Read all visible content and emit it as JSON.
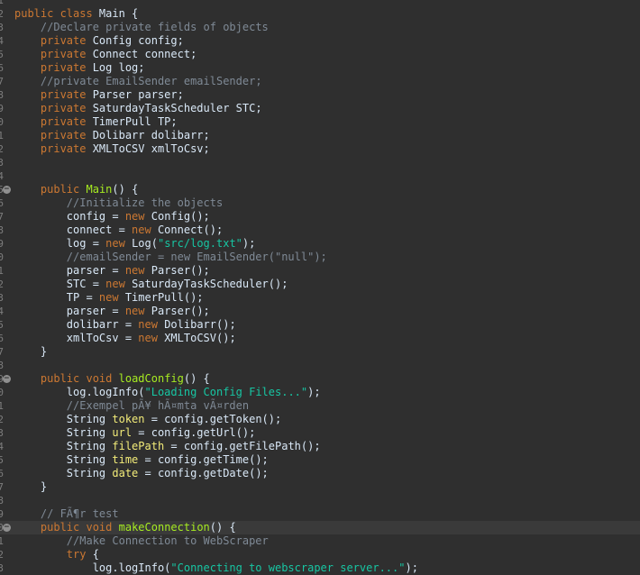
{
  "editor": {
    "language": "java",
    "highlight_line": 39,
    "colors": {
      "background": "#2f2f2f",
      "current_line": "#3a3a3a",
      "keyword": "#cc7832",
      "comment": "#7f8a96",
      "string": "#17c6a3",
      "method": "#a7ec21",
      "local_variable": "#f3ec79",
      "text": "#d9e8f7",
      "line_number": "#7d7d7d"
    },
    "lines": [
      {
        "n": "1",
        "fold": false,
        "tokens": []
      },
      {
        "n": "2",
        "fold": false,
        "tokens": [
          {
            "t": "kw",
            "v": "public class"
          },
          {
            "t": "tx",
            "v": " Main {"
          }
        ]
      },
      {
        "n": "3",
        "fold": false,
        "tokens": [
          {
            "t": "tx",
            "v": "    "
          },
          {
            "t": "cm",
            "v": "//Declare private fields of objects"
          }
        ]
      },
      {
        "n": "4",
        "fold": false,
        "tokens": [
          {
            "t": "tx",
            "v": "    "
          },
          {
            "t": "kw",
            "v": "private"
          },
          {
            "t": "tx",
            "v": " Config config;"
          }
        ]
      },
      {
        "n": "5",
        "fold": false,
        "tokens": [
          {
            "t": "tx",
            "v": "    "
          },
          {
            "t": "kw",
            "v": "private"
          },
          {
            "t": "tx",
            "v": " Connect connect;"
          }
        ]
      },
      {
        "n": "6",
        "fold": false,
        "tokens": [
          {
            "t": "tx",
            "v": "    "
          },
          {
            "t": "kw",
            "v": "private"
          },
          {
            "t": "tx",
            "v": " Log log;"
          }
        ]
      },
      {
        "n": "7",
        "fold": false,
        "tokens": [
          {
            "t": "tx",
            "v": "    "
          },
          {
            "t": "cm",
            "v": "//private EmailSender emailSender;"
          }
        ]
      },
      {
        "n": "8",
        "fold": false,
        "tokens": [
          {
            "t": "tx",
            "v": "    "
          },
          {
            "t": "kw",
            "v": "private"
          },
          {
            "t": "tx",
            "v": " Parser parser;"
          }
        ]
      },
      {
        "n": "9",
        "fold": false,
        "tokens": [
          {
            "t": "tx",
            "v": "    "
          },
          {
            "t": "kw",
            "v": "private"
          },
          {
            "t": "tx",
            "v": " SaturdayTaskScheduler STC;"
          }
        ]
      },
      {
        "n": "0",
        "fold": false,
        "tokens": [
          {
            "t": "tx",
            "v": "    "
          },
          {
            "t": "kw",
            "v": "private"
          },
          {
            "t": "tx",
            "v": " TimerPull TP;"
          }
        ]
      },
      {
        "n": "1",
        "fold": false,
        "tokens": [
          {
            "t": "tx",
            "v": "    "
          },
          {
            "t": "kw",
            "v": "private"
          },
          {
            "t": "tx",
            "v": " Dolibarr dolibarr;"
          }
        ]
      },
      {
        "n": "2",
        "fold": false,
        "tokens": [
          {
            "t": "tx",
            "v": "    "
          },
          {
            "t": "kw",
            "v": "private"
          },
          {
            "t": "tx",
            "v": " XMLToCSV xmlToCsv;"
          }
        ]
      },
      {
        "n": "3",
        "fold": false,
        "tokens": []
      },
      {
        "n": "4",
        "fold": false,
        "tokens": []
      },
      {
        "n": "5",
        "fold": true,
        "tokens": [
          {
            "t": "tx",
            "v": "    "
          },
          {
            "t": "kw",
            "v": "public"
          },
          {
            "t": "tx",
            "v": " "
          },
          {
            "t": "fn",
            "v": "Main"
          },
          {
            "t": "tx",
            "v": "() {"
          }
        ]
      },
      {
        "n": "6",
        "fold": false,
        "tokens": [
          {
            "t": "tx",
            "v": "        "
          },
          {
            "t": "cm",
            "v": "//Initialize the objects"
          }
        ]
      },
      {
        "n": "7",
        "fold": false,
        "tokens": [
          {
            "t": "tx",
            "v": "        config = "
          },
          {
            "t": "kw",
            "v": "new"
          },
          {
            "t": "tx",
            "v": " Config();"
          }
        ]
      },
      {
        "n": "8",
        "fold": false,
        "tokens": [
          {
            "t": "tx",
            "v": "        connect = "
          },
          {
            "t": "kw",
            "v": "new"
          },
          {
            "t": "tx",
            "v": " Connect();"
          }
        ]
      },
      {
        "n": "9",
        "fold": false,
        "tokens": [
          {
            "t": "tx",
            "v": "        log = "
          },
          {
            "t": "kw",
            "v": "new"
          },
          {
            "t": "tx",
            "v": " Log("
          },
          {
            "t": "str",
            "v": "\"src/log.txt\""
          },
          {
            "t": "tx",
            "v": ");"
          }
        ]
      },
      {
        "n": "0",
        "fold": false,
        "tokens": [
          {
            "t": "tx",
            "v": "        "
          },
          {
            "t": "cm",
            "v": "//emailSender = new EmailSender(\"null\");"
          }
        ]
      },
      {
        "n": "1",
        "fold": false,
        "tokens": [
          {
            "t": "tx",
            "v": "        parser = "
          },
          {
            "t": "kw",
            "v": "new"
          },
          {
            "t": "tx",
            "v": " Parser();"
          }
        ]
      },
      {
        "n": "2",
        "fold": false,
        "tokens": [
          {
            "t": "tx",
            "v": "        STC = "
          },
          {
            "t": "kw",
            "v": "new"
          },
          {
            "t": "tx",
            "v": " SaturdayTaskScheduler();"
          }
        ]
      },
      {
        "n": "3",
        "fold": false,
        "tokens": [
          {
            "t": "tx",
            "v": "        TP = "
          },
          {
            "t": "kw",
            "v": "new"
          },
          {
            "t": "tx",
            "v": " TimerPull();"
          }
        ]
      },
      {
        "n": "4",
        "fold": false,
        "tokens": [
          {
            "t": "tx",
            "v": "        parser = "
          },
          {
            "t": "kw",
            "v": "new"
          },
          {
            "t": "tx",
            "v": " Parser();"
          }
        ]
      },
      {
        "n": "5",
        "fold": false,
        "tokens": [
          {
            "t": "tx",
            "v": "        dolibarr = "
          },
          {
            "t": "kw",
            "v": "new"
          },
          {
            "t": "tx",
            "v": " Dolibarr();"
          }
        ]
      },
      {
        "n": "6",
        "fold": false,
        "tokens": [
          {
            "t": "tx",
            "v": "        xmlToCsv = "
          },
          {
            "t": "kw",
            "v": "new"
          },
          {
            "t": "tx",
            "v": " XMLToCSV();"
          }
        ]
      },
      {
        "n": "7",
        "fold": false,
        "tokens": [
          {
            "t": "tx",
            "v": "    }"
          }
        ]
      },
      {
        "n": "8",
        "fold": false,
        "tokens": []
      },
      {
        "n": "9",
        "fold": true,
        "tokens": [
          {
            "t": "tx",
            "v": "    "
          },
          {
            "t": "kw",
            "v": "public void"
          },
          {
            "t": "tx",
            "v": " "
          },
          {
            "t": "fn",
            "v": "loadConfig"
          },
          {
            "t": "tx",
            "v": "() {"
          }
        ]
      },
      {
        "n": "0",
        "fold": false,
        "tokens": [
          {
            "t": "tx",
            "v": "        log.logInfo("
          },
          {
            "t": "str",
            "v": "\"Loading Config Files...\""
          },
          {
            "t": "tx",
            "v": ");"
          }
        ]
      },
      {
        "n": "1",
        "fold": false,
        "tokens": [
          {
            "t": "tx",
            "v": "        "
          },
          {
            "t": "cm",
            "v": "//Exempel pÃ¥ hÃ¤mta vÃ¤rden"
          }
        ]
      },
      {
        "n": "2",
        "fold": false,
        "tokens": [
          {
            "t": "tx",
            "v": "        String "
          },
          {
            "t": "var",
            "v": "token"
          },
          {
            "t": "tx",
            "v": " = config.getToken();"
          }
        ]
      },
      {
        "n": "3",
        "fold": false,
        "tokens": [
          {
            "t": "tx",
            "v": "        String "
          },
          {
            "t": "var",
            "v": "url"
          },
          {
            "t": "tx",
            "v": " = config.getUrl();"
          }
        ]
      },
      {
        "n": "4",
        "fold": false,
        "tokens": [
          {
            "t": "tx",
            "v": "        String "
          },
          {
            "t": "var",
            "v": "filePath"
          },
          {
            "t": "tx",
            "v": " = config.getFilePath();"
          }
        ]
      },
      {
        "n": "5",
        "fold": false,
        "tokens": [
          {
            "t": "tx",
            "v": "        String "
          },
          {
            "t": "var",
            "v": "time"
          },
          {
            "t": "tx",
            "v": " = config.getTime();"
          }
        ]
      },
      {
        "n": "6",
        "fold": false,
        "tokens": [
          {
            "t": "tx",
            "v": "        String "
          },
          {
            "t": "var",
            "v": "date"
          },
          {
            "t": "tx",
            "v": " = config.getDate();"
          }
        ]
      },
      {
        "n": "7",
        "fold": false,
        "tokens": [
          {
            "t": "tx",
            "v": "    }"
          }
        ]
      },
      {
        "n": "8",
        "fold": false,
        "tokens": []
      },
      {
        "n": "9",
        "fold": false,
        "tokens": [
          {
            "t": "tx",
            "v": "    "
          },
          {
            "t": "cm",
            "v": "// FÃ¶r test"
          }
        ]
      },
      {
        "n": "0",
        "fold": true,
        "tokens": [
          {
            "t": "tx",
            "v": "    "
          },
          {
            "t": "kw",
            "v": "public void"
          },
          {
            "t": "tx",
            "v": " "
          },
          {
            "t": "fn",
            "v": "makeConnection"
          },
          {
            "t": "tx",
            "v": "() {"
          }
        ]
      },
      {
        "n": "1",
        "fold": false,
        "tokens": [
          {
            "t": "tx",
            "v": "        "
          },
          {
            "t": "cm",
            "v": "//Make Connection to WebScraper"
          }
        ]
      },
      {
        "n": "2",
        "fold": false,
        "tokens": [
          {
            "t": "tx",
            "v": "        "
          },
          {
            "t": "kw",
            "v": "try"
          },
          {
            "t": "tx",
            "v": " {"
          }
        ]
      },
      {
        "n": "3",
        "fold": false,
        "tokens": [
          {
            "t": "tx",
            "v": "            log.logInfo("
          },
          {
            "t": "str",
            "v": "\"Connecting to webscraper server...\""
          },
          {
            "t": "tx",
            "v": ");"
          }
        ]
      }
    ]
  }
}
